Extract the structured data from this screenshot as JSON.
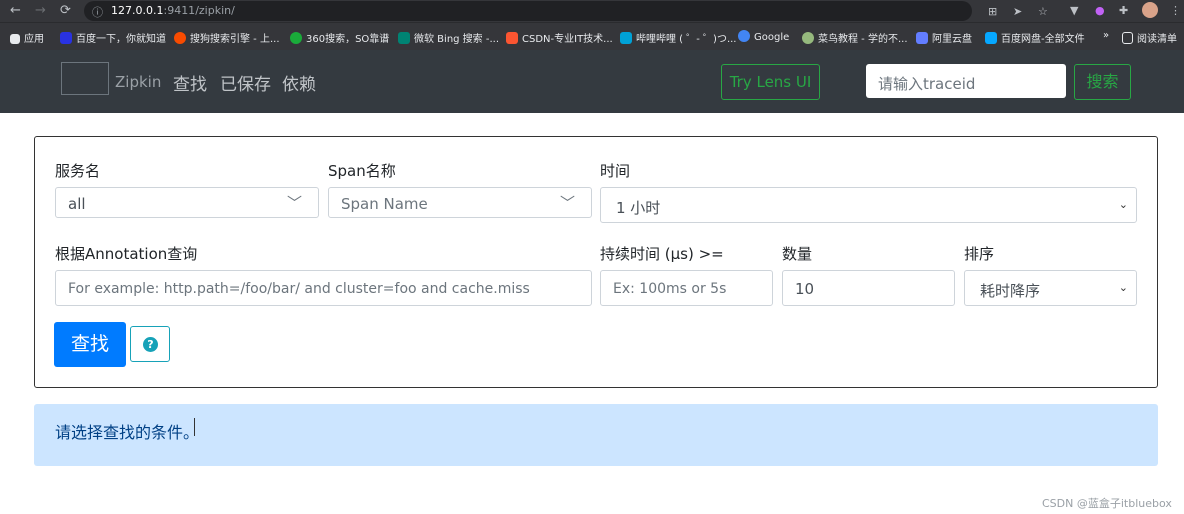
{
  "browser": {
    "url_host": "127.0.0.1",
    "url_port": ":9411",
    "url_path": "/zipkin/",
    "nav_back": "←",
    "nav_forward": "→",
    "nav_reload": "⟳",
    "bookmarks": [
      {
        "label": "应用",
        "color": "#e8eaed"
      },
      {
        "label": "百度一下，你就知道",
        "color": "#2932e1"
      },
      {
        "label": "搜狗搜索引擎 - 上...",
        "color": "#f94b00"
      },
      {
        "label": "360搜索，SO靠谱",
        "color": "#1aab3a"
      },
      {
        "label": "微软 Bing 搜索 -...",
        "color": "#008373"
      },
      {
        "label": "CSDN-专业IT技术...",
        "color": "#fc5531"
      },
      {
        "label": "哔哩哔哩 ( ゜- ゜)つ...",
        "color": "#00a1d6"
      },
      {
        "label": "Google",
        "color": "#4285f4"
      },
      {
        "label": "菜鸟教程 - 学的不...",
        "color": "#96b97d"
      },
      {
        "label": "阿里云盘",
        "color": "#637dff"
      },
      {
        "label": "百度网盘-全部文件",
        "color": "#06a7ff"
      },
      {
        "label": "»",
        "color": ""
      },
      {
        "label": "阅读清单",
        "color": "#e8eaed"
      }
    ]
  },
  "navbar": {
    "brand": "Zipkin",
    "links": [
      "查找",
      "已保存",
      "依赖"
    ],
    "lens_button": "Try Lens UI",
    "trace_placeholder": "请输入traceid",
    "search_button": "搜索"
  },
  "form": {
    "service_label": "服务名",
    "service_value": "all",
    "span_label": "Span名称",
    "span_placeholder": "Span Name",
    "time_label": "时间",
    "time_value": "1 小时",
    "annotation_label": "根据Annotation查询",
    "annotation_placeholder": "For example: http.path=/foo/bar/ and cluster=foo and cache.miss",
    "duration_label": "持续时间 (μs) >=",
    "duration_placeholder": "Ex: 100ms or 5s",
    "limit_label": "数量",
    "limit_value": "10",
    "sort_label": "排序",
    "sort_value": "耗时降序",
    "find_button": "查找",
    "help_icon": "?"
  },
  "alert": {
    "message": "请选择查找的条件。"
  },
  "watermark": "CSDN @蓝盒子itbluebox"
}
